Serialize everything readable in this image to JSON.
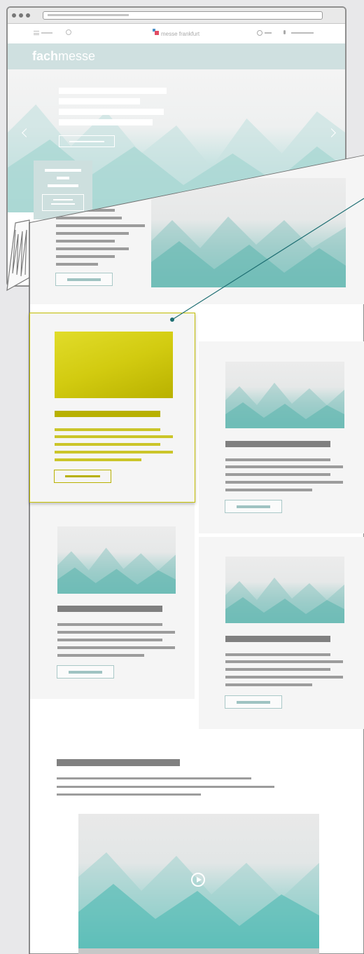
{
  "browser": {
    "url": "",
    "dots": [
      "close",
      "minimize",
      "zoom"
    ]
  },
  "site_header": {
    "menu_icon": "menu-icon",
    "search_icon": "search-icon",
    "logo_text": "messe frankfurt",
    "globe_icon": "globe-icon",
    "user_icon": "user-icon"
  },
  "brand": {
    "bold": "fach",
    "light": "messe"
  },
  "hero": {
    "prev_icon": "chevron-left-icon",
    "next_icon": "chevron-right-icon"
  },
  "highlight": {
    "accent_color": "#c8c200",
    "callout_color": "#1f6f73"
  },
  "video": {
    "play_icon": "play-icon"
  }
}
